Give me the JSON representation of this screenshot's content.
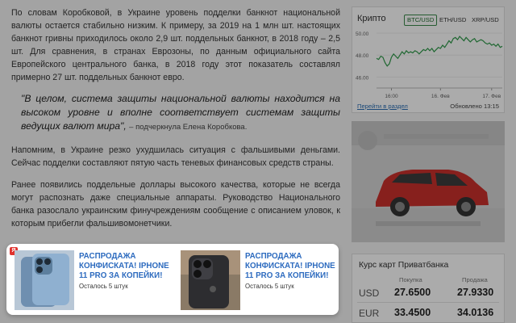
{
  "article": {
    "lead": "По словам Коробковой, в Украине уровень подделки банкнот национальной валюты остается стабильно низким. К примеру, за 2019 на 1 млн шт. настоящих банкнот гривны приходилось около 2,9 шт. поддельных банкнот, в 2018 году – 2,5 шт. Для сравнения, в странах Еврозоны, по данным официального сайта Европейского центрального банка, в 2018 году этот показатель составлял примерно 27 шт. поддельных банкнот евро.",
    "quote": "\"В целом, система защиты национальной валюты находится на высоком уровне и вполне соответствует системам защиты ведущих валют мира\",",
    "quote_author": "– подчеркнула Елена Коробкова.",
    "p2": "Напомним, в Украине резко ухудшилась ситуация с фальшивыми деньгами. Сейчас подделки составляют пятую часть теневых финансовых средств страны.",
    "p3": "Ранее появились поддельные доллары высокого качества, которые не всегда могут распознать даже специальные аппараты. Руководство Национального банка разослало украинским финучреждениям сообщение с описанием уловок, к которым прибегли фальшивомонетчики."
  },
  "crypto": {
    "title": "Крипто",
    "tabs": [
      "BTC/USD",
      "ETH/USD",
      "XRP/USD"
    ],
    "active_tab": 0,
    "link": "Перейти в раздел",
    "updated": "Обновлено 13:15",
    "accent": "#2f9a4a",
    "chart_data": {
      "type": "line",
      "ylim": [
        45.0,
        50.0
      ],
      "ytick_labels": [
        "50.00",
        "48.00",
        "46.00"
      ],
      "yticks": [
        50,
        48,
        46
      ],
      "x": [
        0,
        1,
        2,
        3,
        4,
        5,
        6,
        7,
        8,
        9,
        10,
        11,
        12,
        13,
        14,
        15,
        16,
        17,
        18,
        19,
        20,
        21,
        22,
        23,
        24,
        25,
        26,
        27,
        28,
        29,
        30,
        31,
        32,
        33,
        34,
        35,
        36,
        37,
        38,
        39,
        40,
        41,
        42,
        43,
        44,
        45,
        46,
        47,
        48,
        49,
        50,
        51,
        52,
        53,
        54,
        55,
        56,
        57,
        58,
        59
      ],
      "xtick_labels": [
        "16:00",
        "16. Фев",
        "17. Фев"
      ],
      "xtick_positions": [
        7,
        30,
        54
      ],
      "series": [
        {
          "values": [
            47.7,
            47.6,
            47.9,
            47.8,
            47.3,
            47.0,
            47.2,
            47.8,
            48.1,
            47.9,
            47.7,
            48.0,
            48.3,
            48.1,
            48.4,
            48.2,
            48.3,
            48.2,
            48.4,
            48.3,
            48.1,
            48.3,
            48.5,
            48.4,
            48.6,
            48.4,
            48.6,
            48.3,
            48.5,
            48.7,
            48.6,
            48.9,
            48.7,
            49.0,
            49.3,
            49.1,
            49.5,
            49.6,
            49.4,
            49.7,
            49.5,
            49.3,
            49.6,
            49.4,
            49.2,
            49.4,
            49.5,
            49.2,
            49.3,
            49.4,
            49.3,
            49.1,
            49.0,
            49.1,
            48.9,
            49.0,
            48.8,
            49.0,
            48.7,
            48.8
          ]
        }
      ]
    }
  },
  "bank": {
    "title": "Курс карт Приватбанка",
    "col_buy": "Покупка",
    "col_sell": "Продажа",
    "rows": [
      {
        "cur": "USD",
        "buy": "27.6500",
        "sell": "27.9330"
      },
      {
        "cur": "EUR",
        "buy": "33.4500",
        "sell": "34.0136"
      }
    ]
  },
  "promo": {
    "badge": "Я",
    "items": [
      {
        "title": "Распродажа конфиската! iPhone 11 PRO за копейки!",
        "stock": "Осталось 5 штук"
      },
      {
        "title": "Распродажа конфиската! iPhone 11 PRO за копейки!",
        "stock": "Осталось 5 штук"
      }
    ],
    "title_color": "#2d6bbf"
  }
}
